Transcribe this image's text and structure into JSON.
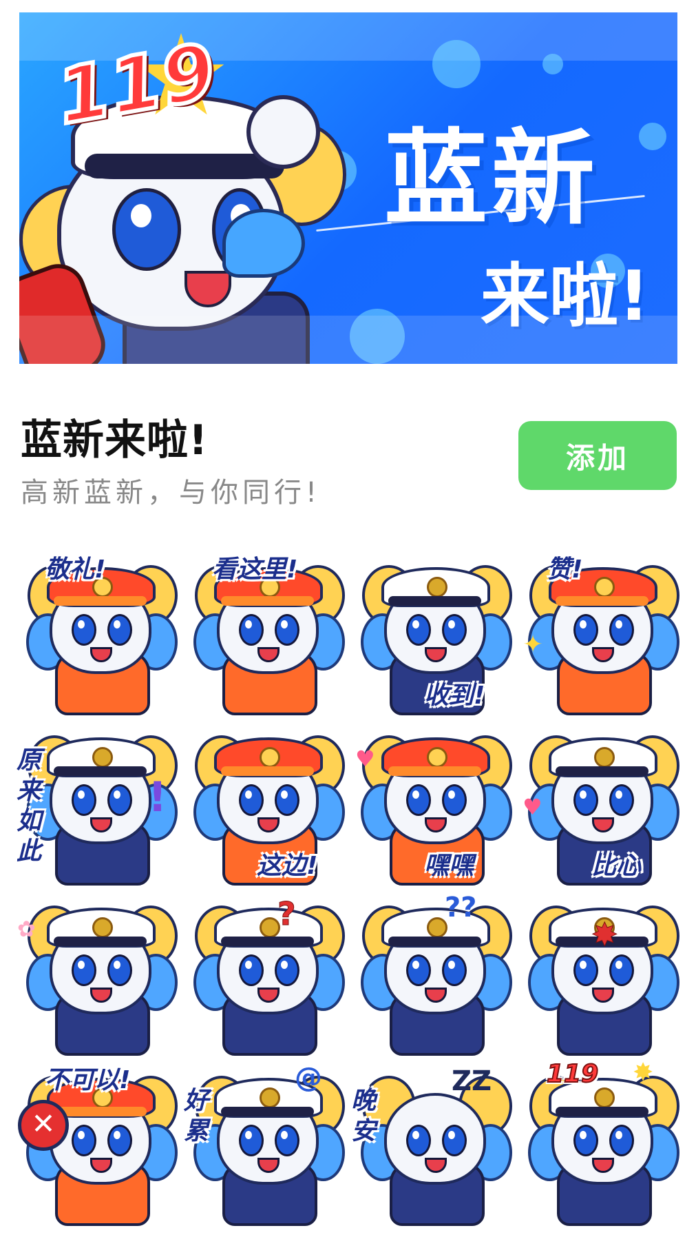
{
  "banner": {
    "badge": "119",
    "title_line1": "蓝新",
    "title_line2": "来啦!"
  },
  "pack": {
    "title": "蓝新来啦!",
    "subtitle": "高新蓝新，与你同行!",
    "add_button": "添加"
  },
  "colors": {
    "banner_blue": "#1d6cff",
    "add_green": "#5fd86a",
    "sticker_text_blue": "#1b2e8c"
  },
  "stickers": [
    {
      "caption": "敬礼!",
      "hat": "helmet",
      "pos": "top"
    },
    {
      "caption": "看这里!",
      "hat": "helmet",
      "pos": "top"
    },
    {
      "caption": "收到!",
      "hat": "cap",
      "pos": "bottom"
    },
    {
      "caption": "赞!",
      "hat": "helmet",
      "pos": "top"
    },
    {
      "caption": "原来如此",
      "hat": "cap",
      "pos": "vert"
    },
    {
      "caption": "这边!",
      "hat": "helmet",
      "pos": "bottom"
    },
    {
      "caption": "嘿嘿",
      "hat": "helmet",
      "pos": "bottom"
    },
    {
      "caption": "比心",
      "hat": "cap",
      "pos": "bottom"
    },
    {
      "caption": "",
      "hat": "cap",
      "pos": "none"
    },
    {
      "caption": "",
      "hat": "cap",
      "pos": "none"
    },
    {
      "caption": "",
      "hat": "cap",
      "pos": "none"
    },
    {
      "caption": "",
      "hat": "cap",
      "pos": "none"
    },
    {
      "caption": "不可以!",
      "hat": "helmet",
      "pos": "top"
    },
    {
      "caption": "好累",
      "hat": "cap",
      "pos": "vert"
    },
    {
      "caption": "晚安",
      "hat": "none",
      "pos": "vert"
    },
    {
      "caption": "119",
      "hat": "cap",
      "pos": "top"
    }
  ]
}
